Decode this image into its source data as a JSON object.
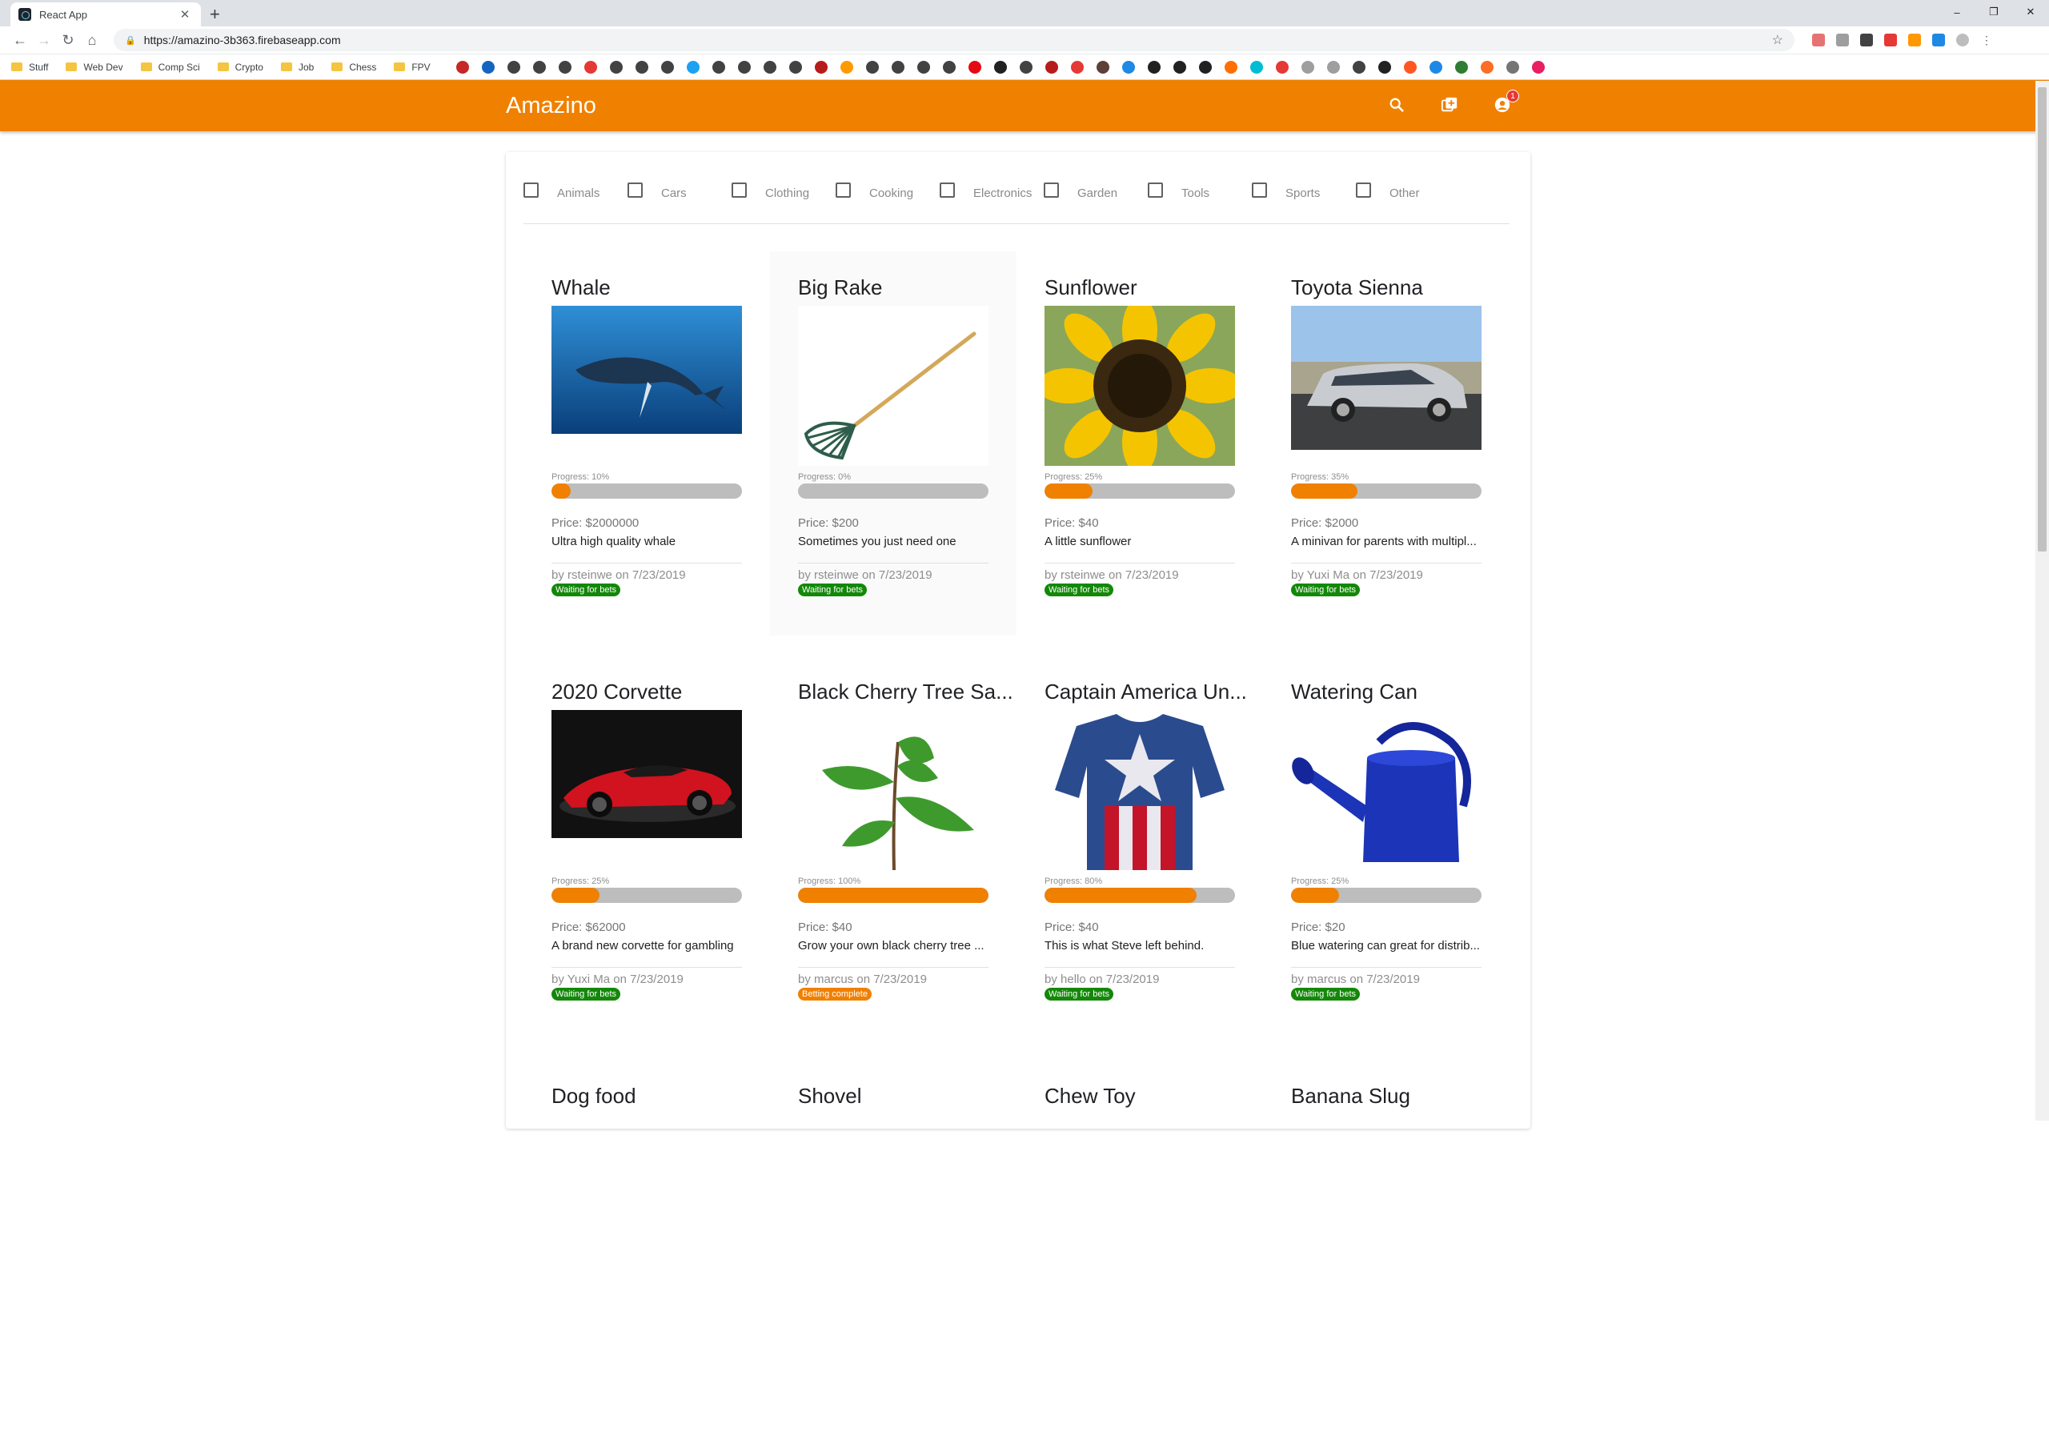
{
  "browser": {
    "tab_title": "React App",
    "tab_close": "✕",
    "new_tab": "+",
    "window_controls": [
      "–",
      "❐",
      "✕"
    ],
    "url": "https://amazino-3b363.firebaseapp.com",
    "bookmarks": [
      "Stuff",
      "Web Dev",
      "Comp Sci",
      "Crypto",
      "Job",
      "Chess",
      "FPV"
    ]
  },
  "app": {
    "brand": "Amazino",
    "icons": [
      "search-icon",
      "add-box-icon",
      "account-icon"
    ],
    "notification_count": "1"
  },
  "filters": [
    "Animals",
    "Cars",
    "Clothing",
    "Cooking",
    "Electronics",
    "Garden",
    "Tools",
    "Sports",
    "Other"
  ],
  "colors": {
    "accent": "#f08000",
    "waiting": "#138808",
    "complete": "#f08000"
  },
  "products": [
    {
      "title": "Whale",
      "image": "whale",
      "progress_text": "Progress: 10%",
      "progress": 10,
      "price": "Price: $2000000",
      "description": "Ultra high quality whale",
      "byline": "by rsteinwe on 7/23/2019",
      "status": "Waiting for bets",
      "status_kind": "waiting"
    },
    {
      "title": "Big Rake",
      "image": "rake",
      "progress_text": "Progress: 0%",
      "progress": 0,
      "price": "Price: $200",
      "description": "Sometimes you just need one",
      "byline": "by rsteinwe on 7/23/2019",
      "status": "Waiting for bets",
      "status_kind": "waiting"
    },
    {
      "title": "Sunflower",
      "image": "sunflower",
      "progress_text": "Progress: 25%",
      "progress": 25,
      "price": "Price: $40",
      "description": "A little sunflower",
      "byline": "by rsteinwe on 7/23/2019",
      "status": "Waiting for bets",
      "status_kind": "waiting"
    },
    {
      "title": "Toyota Sienna",
      "image": "minivan",
      "progress_text": "Progress: 35%",
      "progress": 35,
      "price": "Price: $2000",
      "description": "A minivan for parents with multipl...",
      "byline": "by Yuxi Ma on 7/23/2019",
      "status": "Waiting for bets",
      "status_kind": "waiting"
    },
    {
      "title": "2020 Corvette",
      "image": "corvette",
      "progress_text": "Progress: 25%",
      "progress": 25,
      "price": "Price: $62000",
      "description": "A brand new corvette for gambling",
      "byline": "by Yuxi Ma on 7/23/2019",
      "status": "Waiting for bets",
      "status_kind": "waiting"
    },
    {
      "title": "Black Cherry Tree Sa...",
      "image": "sapling",
      "progress_text": "Progress: 100%",
      "progress": 100,
      "price": "Price: $40",
      "description": "Grow your own black cherry tree ...",
      "byline": "by marcus on 7/23/2019",
      "status": "Betting complete",
      "status_kind": "complete"
    },
    {
      "title": "Captain America Un...",
      "image": "shirt",
      "progress_text": "Progress: 80%",
      "progress": 80,
      "price": "Price: $40",
      "description": "This is what Steve left behind.",
      "byline": "by hello on 7/23/2019",
      "status": "Waiting for bets",
      "status_kind": "waiting"
    },
    {
      "title": "Watering Can",
      "image": "wateringcan",
      "progress_text": "Progress: 25%",
      "progress": 25,
      "price": "Price: $20",
      "description": "Blue watering can great for distrib...",
      "byline": "by marcus on 7/23/2019",
      "status": "Waiting for bets",
      "status_kind": "waiting"
    },
    {
      "title": "Dog food",
      "image": "none"
    },
    {
      "title": "Shovel",
      "image": "none"
    },
    {
      "title": "Chew Toy",
      "image": "none"
    },
    {
      "title": "Banana Slug",
      "image": "none"
    }
  ]
}
